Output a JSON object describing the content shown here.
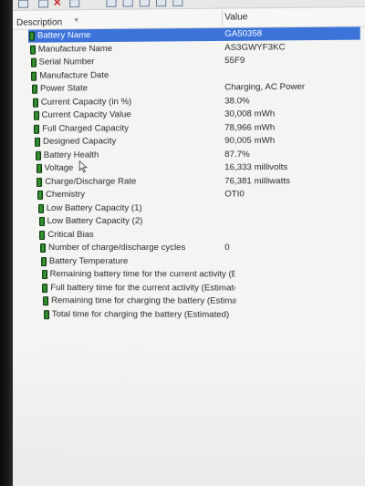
{
  "header": {
    "description_label": "Description",
    "value_label": "Value"
  },
  "toolbar": {
    "icons": [
      "save-icon",
      "delete-icon",
      "report-icon",
      "refresh-icon",
      "options-icon",
      "copy-icon",
      "about-icon"
    ]
  },
  "rows": [
    {
      "label": "Battery Name",
      "value": "GA50358",
      "selected": true
    },
    {
      "label": "Manufacture Name",
      "value": "AS3GWYF3KC"
    },
    {
      "label": "Serial Number",
      "value": "55F9"
    },
    {
      "label": "Manufacture Date",
      "value": ""
    },
    {
      "label": "Power State",
      "value": "Charging, AC Power"
    },
    {
      "label": "Current Capacity (in %)",
      "value": "38.0%"
    },
    {
      "label": "Current Capacity Value",
      "value": "30,008 mWh"
    },
    {
      "label": "Full Charged Capacity",
      "value": "78,966 mWh"
    },
    {
      "label": "Designed Capacity",
      "value": "90,005 mWh"
    },
    {
      "label": "Battery Health",
      "value": "87.7%"
    },
    {
      "label": "Voltage",
      "value": "16,333 millivolts"
    },
    {
      "label": "Charge/Discharge Rate",
      "value": "76,381 milliwatts"
    },
    {
      "label": "Chemistry",
      "value": "OTI0"
    },
    {
      "label": "Low Battery Capacity (1)",
      "value": ""
    },
    {
      "label": "Low Battery Capacity (2)",
      "value": ""
    },
    {
      "label": "Critical Bias",
      "value": ""
    },
    {
      "label": "Number of charge/discharge cycles",
      "value": "0"
    },
    {
      "label": "Battery Temperature",
      "value": ""
    },
    {
      "label": "Remaining battery time for the current activity (Est...",
      "value": ""
    },
    {
      "label": "Full battery time for the current activity (Estimated)",
      "value": ""
    },
    {
      "label": "Remaining time for charging the battery (Estimated)",
      "value": ""
    },
    {
      "label": "Total  time for charging the battery (Estimated)",
      "value": ""
    }
  ]
}
